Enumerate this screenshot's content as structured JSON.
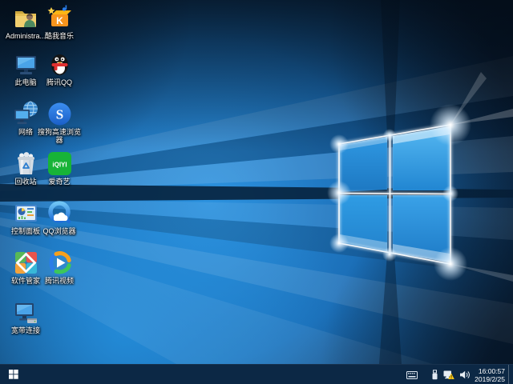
{
  "desktop": {
    "icons": [
      {
        "label": "Administra...",
        "name": "administrator-folder"
      },
      {
        "label": "酷我音乐",
        "name": "kuwo-music",
        "icon_text": "K"
      },
      {
        "label": "此电脑",
        "name": "this-pc"
      },
      {
        "label": "腾讯QQ",
        "name": "tencent-qq"
      },
      {
        "label": "网络",
        "name": "network"
      },
      {
        "label": "搜狗高速浏览器",
        "name": "sogou-browser",
        "icon_text": "S"
      },
      {
        "label": "回收站",
        "name": "recycle-bin"
      },
      {
        "label": "爱奇艺",
        "name": "iqiyi",
        "icon_text": "iQIYI"
      },
      {
        "label": "控制面板",
        "name": "control-panel"
      },
      {
        "label": "QQ浏览器",
        "name": "qq-browser"
      },
      {
        "label": "软件管家",
        "name": "software-manager"
      },
      {
        "label": "腾讯视频",
        "name": "tencent-video"
      },
      {
        "label": "宽带连接",
        "name": "broadband-connection"
      }
    ]
  },
  "taskbar": {
    "clock": {
      "time": "16:00:57",
      "date": "2019/2/25"
    },
    "tray_icons": [
      "touch-keyboard",
      "usb-device",
      "network-warning",
      "volume"
    ]
  },
  "colors": {
    "taskbar": "#0c2845",
    "wallpaper_bright": "#2e93e0",
    "wallpaper_dark": "#081d33",
    "warning_yellow": "#f8c718"
  }
}
